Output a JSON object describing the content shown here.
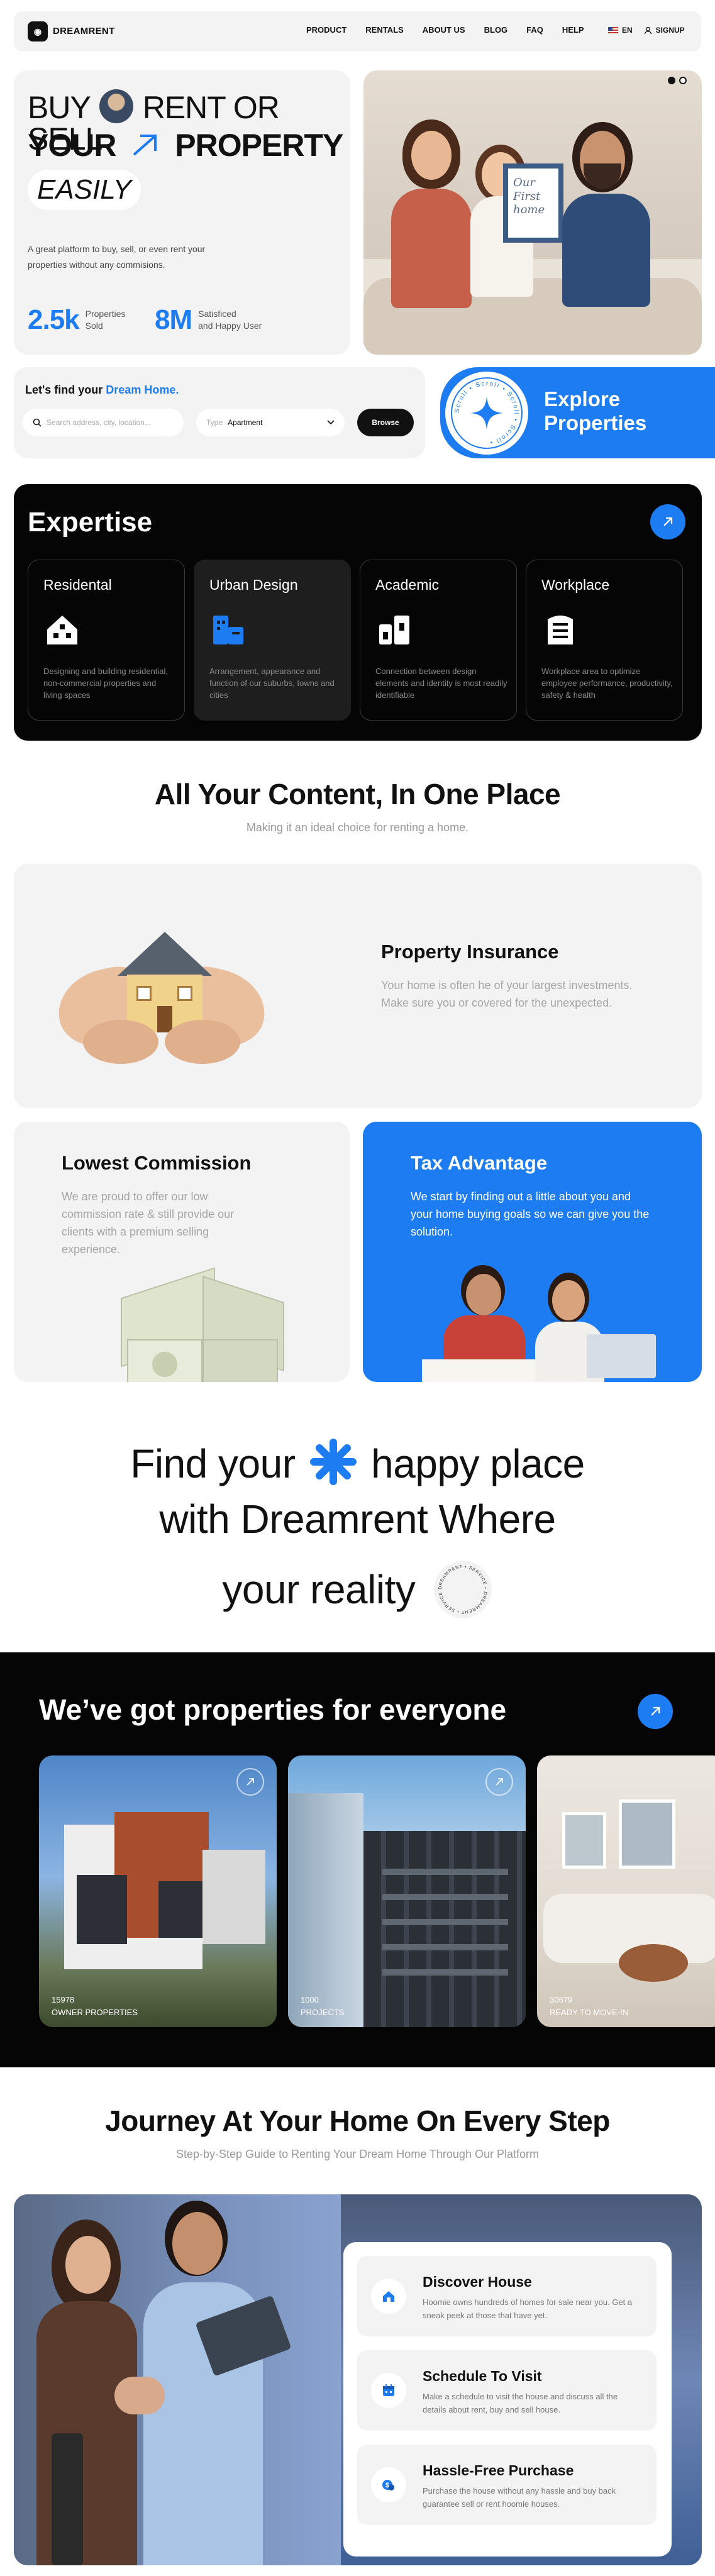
{
  "nav": {
    "logo_text": "DREAMRENT",
    "links": [
      "PRODUCT",
      "RENTALS",
      "ABOUT US",
      "BLOG",
      "FAQ",
      "HELP"
    ],
    "language": "EN",
    "signup": "SIGNUP"
  },
  "hero": {
    "line1a": "BUY",
    "line1b": "RENT OR SELL",
    "line2a": "YOUR",
    "line2b": "PROPERTY",
    "line3": "EASILY",
    "description": "A great platform to buy, sell, or even rent your properties without any commisions.",
    "stats": [
      {
        "value": "2.5k",
        "label1": "Properties",
        "label2": "Sold"
      },
      {
        "value": "8M",
        "label1": "Satisficed",
        "label2": "and Happy User"
      }
    ],
    "photo_sign": [
      "Our",
      "First",
      "home"
    ]
  },
  "search": {
    "title_prefix": "Let's find your ",
    "title_highlight": "Dream Home.",
    "placeholder": "Search address, city, location...",
    "type_label": "Type",
    "type_value": "Apartment",
    "browse": "Browse"
  },
  "explore": {
    "line1": "Explore",
    "line2": "Properties",
    "ring_text": "Scroll • Scroll • Scroll • Scroll •"
  },
  "expertise": {
    "title": "Expertise",
    "cards": [
      {
        "title": "Residental",
        "icon": "house-icon",
        "desc": "Designing and building residential, non-commercial properties and living spaces"
      },
      {
        "title": "Urban Design",
        "icon": "city-icon",
        "desc": "Arrangement, appearance and function of our suburbs, towns and cities"
      },
      {
        "title": "Academic",
        "icon": "academic-building-icon",
        "desc": "Connection between design elements and identity is most readily identifiable"
      },
      {
        "title": "Workplace",
        "icon": "office-building-icon",
        "desc": "Workplace area to optimize employee performance, productivity, safety & health"
      }
    ]
  },
  "content": {
    "title": "All Your Content, In One Place",
    "subtitle": "Making it an ideal choice for renting a home.",
    "insurance_title": "Property Insurance",
    "insurance_desc": "Your home is often he of your largest investments. Make sure you or covered for the unexpected.",
    "commission_title": "Lowest Commission",
    "commission_desc": "We are proud to offer our low commission rate & still provide our clients with a premium selling experience.",
    "tax_title": "Tax Advantage",
    "tax_desc": "We start by finding out a little about you and your home buying goals so we can give you the solution."
  },
  "happy": {
    "w1": "Find your",
    "w2": "happy place",
    "w3": "with",
    "w4": "Dreamrent Where",
    "w5": "your",
    "w6": "reality",
    "badge_text": "DREAMRENT • SERVICE • DREAMRENT • SERVICE •"
  },
  "properties": {
    "title": "We’ve got properties for everyone",
    "cards": [
      {
        "number": "15978",
        "label": "OWNER PROPERTIES"
      },
      {
        "number": "1000",
        "label": "PROJECTS"
      },
      {
        "number": "30679",
        "label": "READY TO MOVE-IN"
      }
    ]
  },
  "journey": {
    "title": "Journey At Your Home On Every Step",
    "subtitle": "Step-by-Step Guide to Renting Your Dream Home Through Our Platform",
    "steps": [
      {
        "title": "Discover House",
        "icon": "house-icon",
        "desc": "Hoomie owns hundreds of homes for sale near you. Get a sneak peek at those that have yet."
      },
      {
        "title": "Schedule To Visit",
        "icon": "calendar-icon",
        "desc": "Make a schedule to visit the house and discuss all the details about rent, buy and sell house."
      },
      {
        "title": "Hassle-Free Purchase",
        "icon": "money-icon",
        "desc": "Purchase the house without any hassle and buy back guarantee sell or rent hoomie houses."
      }
    ]
  },
  "colors": {
    "accent": "#1e7cf2",
    "dark": "#050505",
    "card_bg": "#f3f3f3"
  }
}
